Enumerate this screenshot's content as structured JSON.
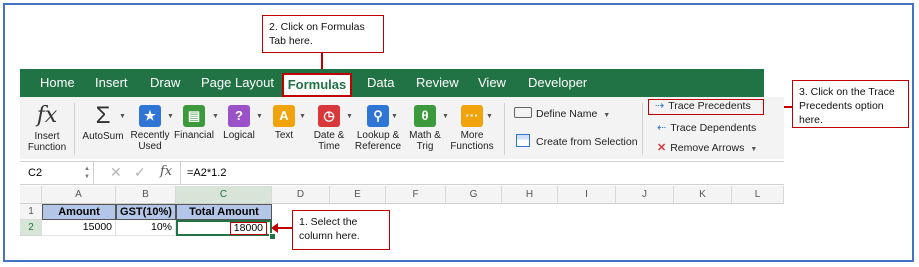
{
  "callouts": {
    "formulas_tab": "2. Click on Formulas Tab here.",
    "trace_precedents": "3. Click on the Trace Precedents option here.",
    "select_column": "1. Select the column here."
  },
  "tabs": [
    {
      "label": "Home"
    },
    {
      "label": "Insert"
    },
    {
      "label": "Draw"
    },
    {
      "label": "Page Layout"
    },
    {
      "label": "Formulas"
    },
    {
      "label": "Data"
    },
    {
      "label": "Review"
    },
    {
      "label": "View"
    },
    {
      "label": "Developer"
    }
  ],
  "ribbon": {
    "insert_function": {
      "icon": "fx",
      "label1": "Insert",
      "label2": "Function"
    },
    "autosum": {
      "icon": "Σ",
      "label": "AutoSum"
    },
    "recently_used": {
      "label1": "Recently",
      "label2": "Used"
    },
    "financial": {
      "label": "Financial"
    },
    "logical": {
      "label": "Logical"
    },
    "text": {
      "label": "Text"
    },
    "date_time": {
      "label1": "Date &",
      "label2": "Time"
    },
    "lookup": {
      "label1": "Lookup &",
      "label2": "Reference"
    },
    "math": {
      "label1": "Math &",
      "label2": "Trig"
    },
    "more": {
      "label1": "More",
      "label2": "Functions"
    },
    "define_name": "Define Name",
    "create_from_selection": "Create from Selection",
    "trace_precedents": "Trace Precedents",
    "trace_dependents": "Trace Dependents",
    "remove_arrows": "Remove Arrows"
  },
  "formula_bar": {
    "name_box": "C2",
    "fx": "fx",
    "formula": "=A2*1.2"
  },
  "grid": {
    "columns": [
      "A",
      "B",
      "C",
      "D",
      "E",
      "F",
      "G",
      "H",
      "I",
      "J",
      "K",
      "L"
    ],
    "rows": [
      "1",
      "2"
    ],
    "header_row": [
      "Amount",
      "GST(10%)",
      "Total Amount"
    ],
    "data_row": [
      "15000",
      "10%",
      "18000"
    ]
  },
  "colors": {
    "excel_green": "#217346",
    "callout_border": "#c00000",
    "frame": "#4472c4",
    "header_fill": "#b4c6e7"
  }
}
